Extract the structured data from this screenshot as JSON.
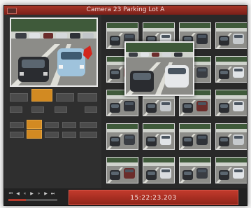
{
  "window": {
    "title": "Camera 23 Parking Lot A"
  },
  "preview": {
    "caption": ""
  },
  "controls": {
    "row1": [
      "",
      "",
      "",
      ""
    ],
    "row2": [
      "",
      "",
      "",
      ""
    ],
    "row3": [
      "",
      "",
      "",
      "",
      ""
    ],
    "row4": [
      "",
      "",
      "",
      "",
      ""
    ],
    "active": [
      "row1.1",
      "row3.1",
      "row4.1"
    ]
  },
  "grid": {
    "rows": 5,
    "cols": 4
  },
  "playback": {
    "buttons": [
      "skip-back-icon",
      "step-back-icon",
      "rewind-icon",
      "play-icon",
      "fast-forward-icon",
      "step-forward-icon",
      "skip-forward-icon"
    ],
    "progress": 0.35
  },
  "timestamp": {
    "label": "",
    "value": "15:22:23.203"
  },
  "colors": {
    "accent": "#b53a2c",
    "active_button": "#d28a22",
    "window_bg": "#2c2c2c"
  }
}
